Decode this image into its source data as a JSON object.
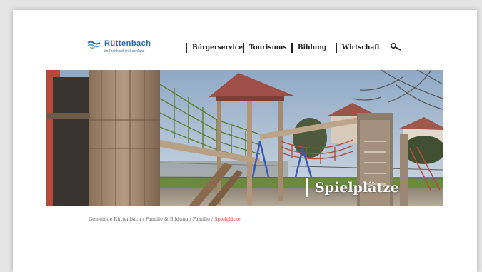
{
  "header": {
    "logo": {
      "name": "Rüttenbach",
      "tagline": "im Fränkischen Seenland"
    },
    "nav": [
      {
        "label": "Bürgerservice"
      },
      {
        "label": "Tourismus"
      },
      {
        "label": "Bildung"
      },
      {
        "label": "Wirtschaft"
      }
    ],
    "search_icon": "search-icon"
  },
  "hero": {
    "title": "Spielplätze",
    "image_subject": "playground with wooden climbing tower, slide and rope net"
  },
  "breadcrumb": {
    "items": [
      "Gemeinde Rüttenbach",
      "Familie & Bildung",
      "Familie"
    ],
    "current": "Spielplätze",
    "separator": "/"
  },
  "colors": {
    "breadcrumb_current": "#e0413a",
    "logo_blue": "#2a6aa8",
    "logo_green": "#6ab04c"
  }
}
